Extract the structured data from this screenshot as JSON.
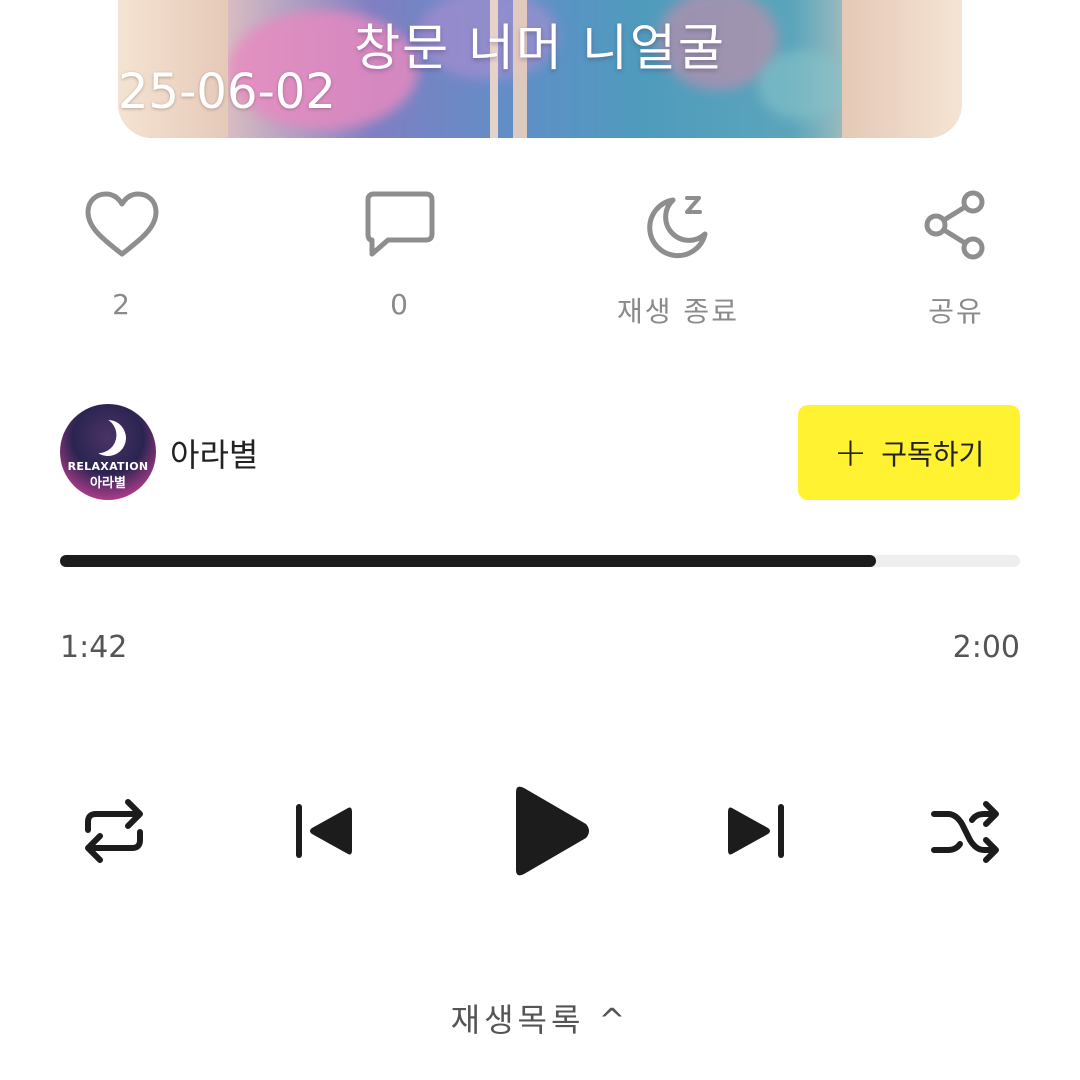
{
  "cover": {
    "title": "창문 너머 니얼굴",
    "date": "25-06-02"
  },
  "actions": {
    "like": {
      "icon": "heart-icon",
      "label": "2"
    },
    "comment": {
      "icon": "speech-bubble-icon",
      "label": "0"
    },
    "sleep_timer": {
      "icon": "moon-sleep-icon",
      "label": "재생 종료"
    },
    "share": {
      "icon": "share-icon",
      "label": "공유"
    }
  },
  "channel": {
    "name": "아라별",
    "avatar_text_top": "RELAXATION",
    "avatar_text_bottom": "아라별",
    "subscribe_label": "구독하기",
    "subscribe_color": "#fff231"
  },
  "player": {
    "current_time": "1:42",
    "total_time": "2:00",
    "progress": 0.85,
    "controls": [
      "repeat-icon",
      "previous-icon",
      "play-icon",
      "next-icon",
      "shuffle-icon"
    ]
  },
  "footer": {
    "playlist_label": "재생목록 ^"
  }
}
